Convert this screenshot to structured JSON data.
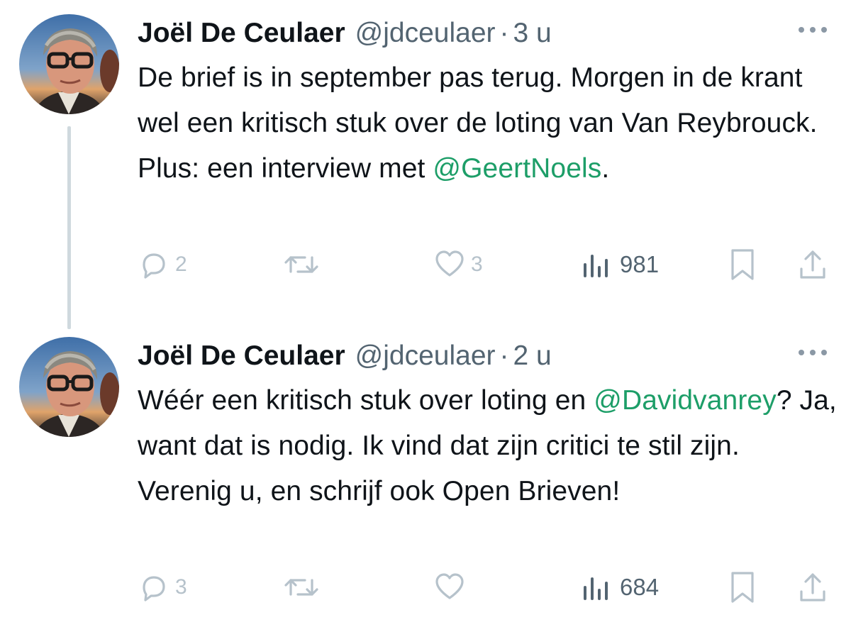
{
  "tweets": [
    {
      "author_name": "Joël De Ceulaer",
      "author_handle": "@jdceulaer",
      "separator": "·",
      "time": "3 u",
      "text_parts": {
        "p1": "De brief is in september pas terug. Morgen in de krant wel een kritisch stuk over de loting van Van Reybrouck. Plus: een interview met ",
        "mention1": "@GeertNoels",
        "p2": "."
      },
      "reply_count": "2",
      "retweet_count": "",
      "like_count": "3",
      "view_count": "981"
    },
    {
      "author_name": "Joël De Ceulaer",
      "author_handle": "@jdceulaer",
      "separator": "·",
      "time": "2 u",
      "text_parts": {
        "p1": "Wéér een kritisch stuk over loting en ",
        "mention1": "@Davidvanrey",
        "p2": "? Ja, want dat is nodig. Ik vind dat zijn critici te stil zijn. Verenig u, en schrijf ook Open Brieven!"
      },
      "reply_count": "3",
      "retweet_count": "",
      "like_count": "",
      "view_count": "684"
    }
  ],
  "icons": {
    "more": "more-horizontal-icon",
    "reply": "reply-icon",
    "retweet": "retweet-icon",
    "like": "heart-icon",
    "views": "views-chart-icon",
    "bookmark": "bookmark-icon",
    "share": "share-icon"
  },
  "colors": {
    "mention": "#1d9e68",
    "muted": "#536471",
    "action_faded": "#b6c2cb",
    "thread_line": "#cfd9de"
  }
}
